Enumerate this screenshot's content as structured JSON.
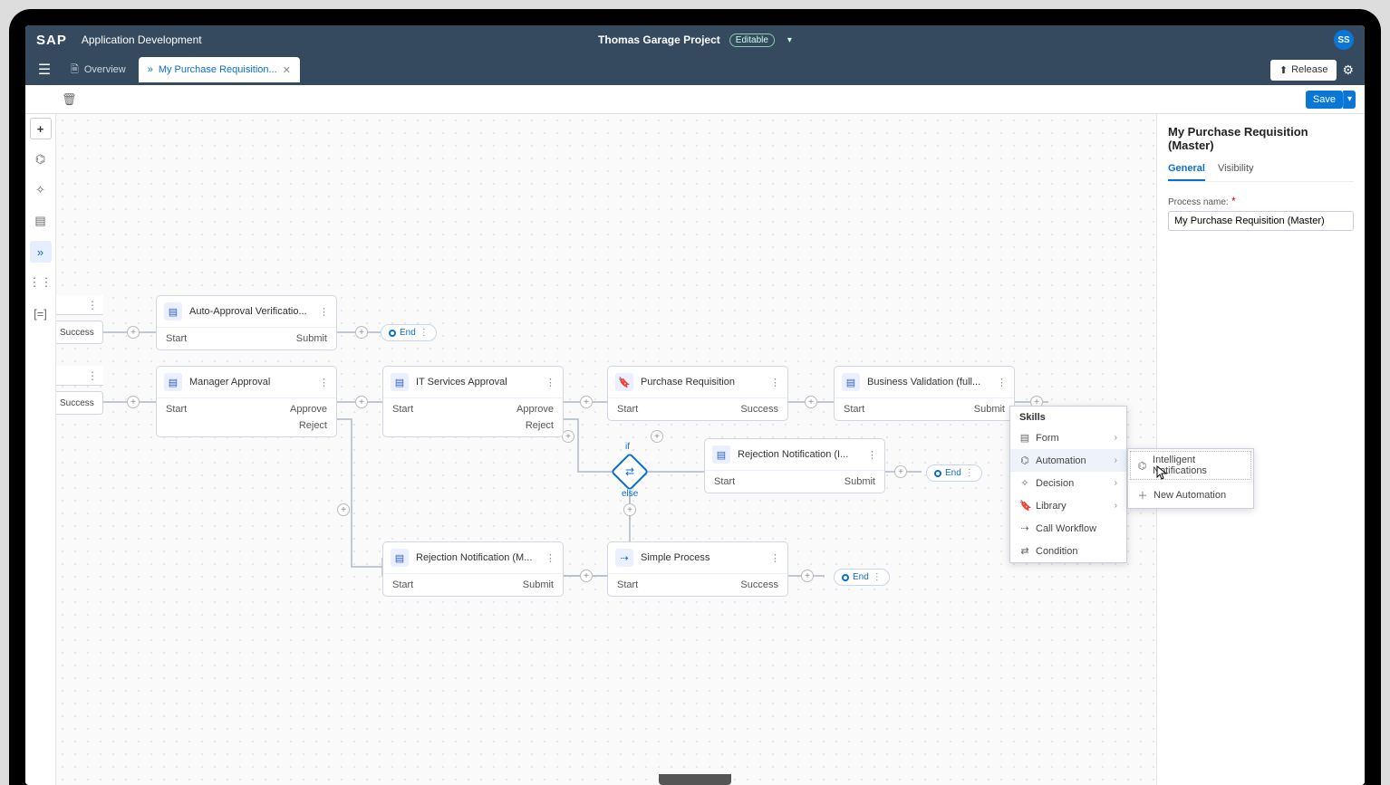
{
  "header": {
    "logo": "SAP",
    "app_title": "Application Development",
    "project_name": "Thomas Garage Project",
    "status_pill": "Editable",
    "avatar": "SS"
  },
  "tabs": {
    "overview": "Overview",
    "active_tab": "My Purchase Requisition..."
  },
  "actions": {
    "release": "Release",
    "save": "Save"
  },
  "canvas": {
    "stub1": "Success",
    "stub2": "Success",
    "nodes": {
      "auto_approval": {
        "title": "Auto-Approval Verificatio...",
        "left": "Start",
        "right": "Submit"
      },
      "manager_approval": {
        "title": "Manager Approval",
        "left": "Start",
        "right": "Approve",
        "right2": "Reject"
      },
      "it_approval": {
        "title": "IT Services Approval",
        "left": "Start",
        "right": "Approve",
        "right2": "Reject"
      },
      "purchase_req": {
        "title": "Purchase Requisition",
        "left": "Start",
        "right": "Success"
      },
      "biz_validation": {
        "title": "Business Validation (full...",
        "left": "Start",
        "right": "Submit"
      },
      "rej_notif_i": {
        "title": "Rejection Notification (I...",
        "left": "Start",
        "right": "Submit"
      },
      "rej_notif_m": {
        "title": "Rejection Notification (M...",
        "left": "Start",
        "right": "Submit"
      },
      "simple_process": {
        "title": "Simple Process",
        "left": "Start",
        "right": "Success"
      }
    },
    "decision": {
      "if": "if",
      "else": "else"
    },
    "end": "End"
  },
  "right_panel": {
    "title": "My Purchase Requisition (Master)",
    "tabs": {
      "general": "General",
      "visibility": "Visibility"
    },
    "process_name_label": "Process name:",
    "process_name_value": "My Purchase Requisition (Master)"
  },
  "skills_menu": {
    "header": "Skills",
    "form": "Form",
    "automation": "Automation",
    "decision": "Decision",
    "library": "Library",
    "call_workflow": "Call Workflow",
    "condition": "Condition",
    "submenu": {
      "intelligent": "Intelligent Notifications",
      "new_automation": "New Automation"
    }
  }
}
